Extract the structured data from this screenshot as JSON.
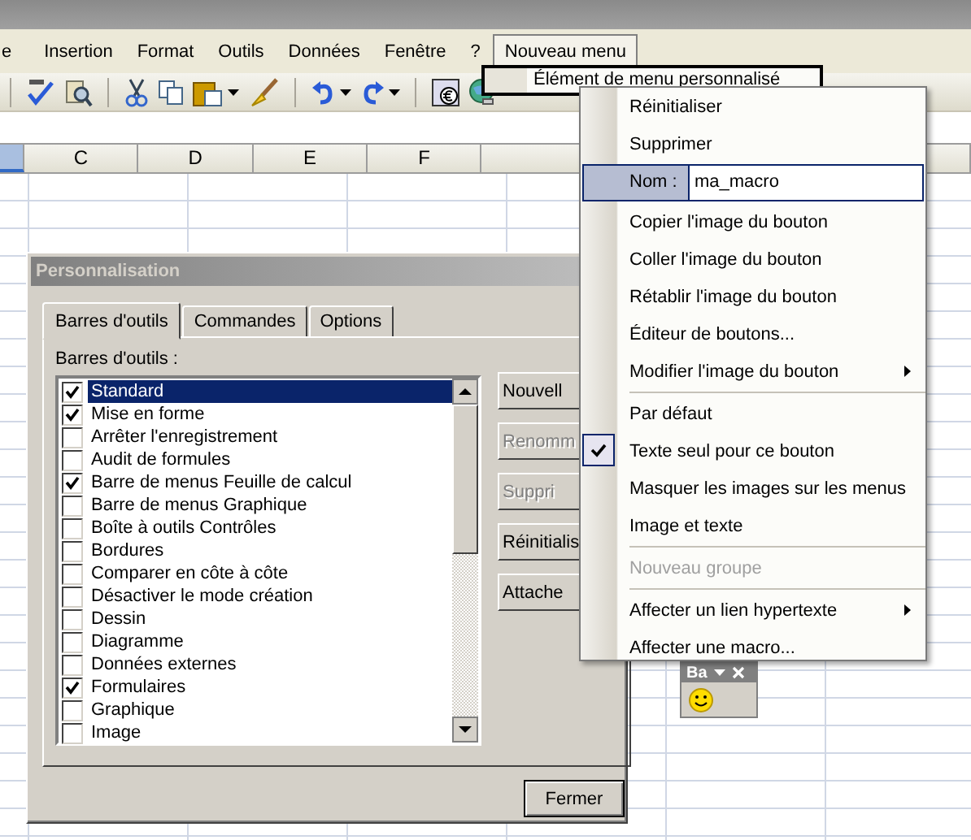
{
  "menu_bar": {
    "items": [
      {
        "label": "e",
        "selected": false
      },
      {
        "label": "Insertion",
        "selected": false
      },
      {
        "label": "Format",
        "selected": false
      },
      {
        "label": "Outils",
        "selected": false
      },
      {
        "label": "Données",
        "selected": false
      },
      {
        "label": "Fenêtre",
        "selected": false
      },
      {
        "label": "?",
        "selected": false
      },
      {
        "label": "Nouveau menu",
        "selected": true
      }
    ]
  },
  "dropdown": {
    "items": [
      "Élément de menu personnalisé"
    ]
  },
  "sheet": {
    "left_column_selected": true,
    "columns": [
      "C",
      "D",
      "E",
      "F"
    ]
  },
  "dialog": {
    "title": "Personnalisation",
    "tabs": [
      {
        "label": "Barres d'outils",
        "selected": true
      },
      {
        "label": "Commandes",
        "selected": false
      },
      {
        "label": "Options",
        "selected": false
      }
    ],
    "list_label": "Barres d'outils :",
    "toolbars": [
      {
        "label": "Standard",
        "checked": true,
        "selected": true
      },
      {
        "label": "Mise en forme",
        "checked": true,
        "selected": false
      },
      {
        "label": "Arrêter l'enregistrement",
        "checked": false,
        "selected": false
      },
      {
        "label": "Audit de formules",
        "checked": false,
        "selected": false
      },
      {
        "label": "Barre de menus Feuille de calcul",
        "checked": true,
        "selected": false
      },
      {
        "label": "Barre de menus Graphique",
        "checked": false,
        "selected": false
      },
      {
        "label": "Boîte à outils Contrôles",
        "checked": false,
        "selected": false
      },
      {
        "label": "Bordures",
        "checked": false,
        "selected": false
      },
      {
        "label": "Comparer en côte à côte",
        "checked": false,
        "selected": false
      },
      {
        "label": "Désactiver le mode création",
        "checked": false,
        "selected": false
      },
      {
        "label": "Dessin",
        "checked": false,
        "selected": false
      },
      {
        "label": "Diagramme",
        "checked": false,
        "selected": false
      },
      {
        "label": "Données externes",
        "checked": false,
        "selected": false
      },
      {
        "label": "Formulaires",
        "checked": true,
        "selected": false
      },
      {
        "label": "Graphique",
        "checked": false,
        "selected": false
      },
      {
        "label": "Image",
        "checked": false,
        "selected": false
      }
    ],
    "buttons": [
      {
        "label": "Nouvell",
        "disabled": false
      },
      {
        "label": "Renomm",
        "disabled": true
      },
      {
        "label": "Suppri",
        "disabled": true
      },
      {
        "label": "Réinitialis",
        "disabled": false
      },
      {
        "label": "Attache",
        "disabled": false
      }
    ],
    "close_button": "Fermer"
  },
  "context_menu": {
    "items": [
      {
        "kind": "item",
        "label": "Réinitialiser",
        "checked": false,
        "disabled": false,
        "submenu": false
      },
      {
        "kind": "item",
        "label": "Supprimer",
        "checked": false,
        "disabled": false,
        "submenu": false
      },
      {
        "kind": "field",
        "label": "Nom :",
        "value": "ma_macro"
      },
      {
        "kind": "item",
        "label": "Copier l'image du bouton",
        "checked": false,
        "disabled": false,
        "submenu": false
      },
      {
        "kind": "item",
        "label": "Coller l'image du bouton",
        "checked": false,
        "disabled": false,
        "submenu": false
      },
      {
        "kind": "item",
        "label": "Rétablir l'image du bouton",
        "checked": false,
        "disabled": false,
        "submenu": false
      },
      {
        "kind": "item",
        "label": "Éditeur de boutons...",
        "checked": false,
        "disabled": false,
        "submenu": false
      },
      {
        "kind": "item",
        "label": "Modifier l'image du bouton",
        "checked": false,
        "disabled": false,
        "submenu": true
      },
      {
        "kind": "separator"
      },
      {
        "kind": "item",
        "label": "Par défaut",
        "checked": false,
        "disabled": false,
        "submenu": false
      },
      {
        "kind": "item",
        "label": "Texte seul pour ce bouton",
        "checked": true,
        "disabled": false,
        "submenu": false
      },
      {
        "kind": "item",
        "label": "Masquer les images sur les menus",
        "checked": false,
        "disabled": false,
        "submenu": false
      },
      {
        "kind": "item",
        "label": "Image et texte",
        "checked": false,
        "disabled": false,
        "submenu": false
      },
      {
        "kind": "separator"
      },
      {
        "kind": "item",
        "label": "Nouveau groupe",
        "checked": false,
        "disabled": true,
        "submenu": false
      },
      {
        "kind": "separator"
      },
      {
        "kind": "item",
        "label": "Affecter un lien hypertexte",
        "checked": false,
        "disabled": false,
        "submenu": true
      },
      {
        "kind": "item",
        "label": "Affecter une macro...",
        "checked": false,
        "disabled": false,
        "submenu": false
      }
    ]
  },
  "floating_toolbar": {
    "title": "Ba"
  }
}
